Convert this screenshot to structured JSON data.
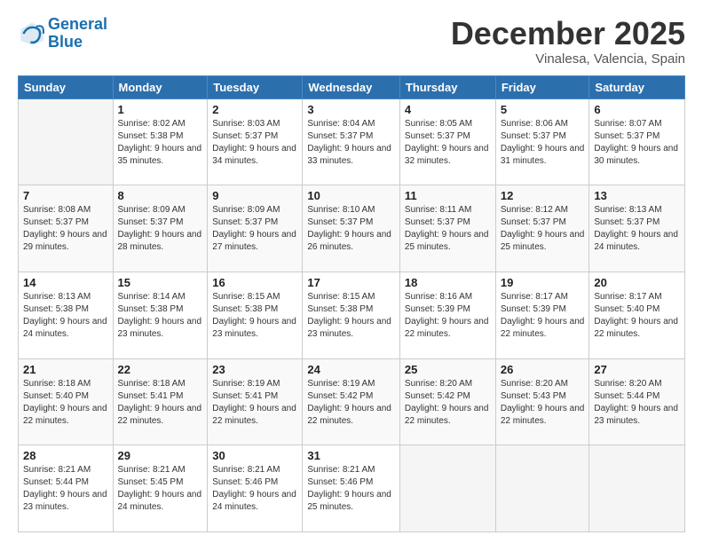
{
  "header": {
    "logo_line1": "General",
    "logo_line2": "Blue",
    "month": "December 2025",
    "location": "Vinalesa, Valencia, Spain"
  },
  "days_of_week": [
    "Sunday",
    "Monday",
    "Tuesday",
    "Wednesday",
    "Thursday",
    "Friday",
    "Saturday"
  ],
  "weeks": [
    [
      {
        "num": "",
        "sunrise": "",
        "sunset": "",
        "daylight": ""
      },
      {
        "num": "1",
        "sunrise": "Sunrise: 8:02 AM",
        "sunset": "Sunset: 5:38 PM",
        "daylight": "Daylight: 9 hours and 35 minutes."
      },
      {
        "num": "2",
        "sunrise": "Sunrise: 8:03 AM",
        "sunset": "Sunset: 5:37 PM",
        "daylight": "Daylight: 9 hours and 34 minutes."
      },
      {
        "num": "3",
        "sunrise": "Sunrise: 8:04 AM",
        "sunset": "Sunset: 5:37 PM",
        "daylight": "Daylight: 9 hours and 33 minutes."
      },
      {
        "num": "4",
        "sunrise": "Sunrise: 8:05 AM",
        "sunset": "Sunset: 5:37 PM",
        "daylight": "Daylight: 9 hours and 32 minutes."
      },
      {
        "num": "5",
        "sunrise": "Sunrise: 8:06 AM",
        "sunset": "Sunset: 5:37 PM",
        "daylight": "Daylight: 9 hours and 31 minutes."
      },
      {
        "num": "6",
        "sunrise": "Sunrise: 8:07 AM",
        "sunset": "Sunset: 5:37 PM",
        "daylight": "Daylight: 9 hours and 30 minutes."
      }
    ],
    [
      {
        "num": "7",
        "sunrise": "Sunrise: 8:08 AM",
        "sunset": "Sunset: 5:37 PM",
        "daylight": "Daylight: 9 hours and 29 minutes."
      },
      {
        "num": "8",
        "sunrise": "Sunrise: 8:09 AM",
        "sunset": "Sunset: 5:37 PM",
        "daylight": "Daylight: 9 hours and 28 minutes."
      },
      {
        "num": "9",
        "sunrise": "Sunrise: 8:09 AM",
        "sunset": "Sunset: 5:37 PM",
        "daylight": "Daylight: 9 hours and 27 minutes."
      },
      {
        "num": "10",
        "sunrise": "Sunrise: 8:10 AM",
        "sunset": "Sunset: 5:37 PM",
        "daylight": "Daylight: 9 hours and 26 minutes."
      },
      {
        "num": "11",
        "sunrise": "Sunrise: 8:11 AM",
        "sunset": "Sunset: 5:37 PM",
        "daylight": "Daylight: 9 hours and 25 minutes."
      },
      {
        "num": "12",
        "sunrise": "Sunrise: 8:12 AM",
        "sunset": "Sunset: 5:37 PM",
        "daylight": "Daylight: 9 hours and 25 minutes."
      },
      {
        "num": "13",
        "sunrise": "Sunrise: 8:13 AM",
        "sunset": "Sunset: 5:37 PM",
        "daylight": "Daylight: 9 hours and 24 minutes."
      }
    ],
    [
      {
        "num": "14",
        "sunrise": "Sunrise: 8:13 AM",
        "sunset": "Sunset: 5:38 PM",
        "daylight": "Daylight: 9 hours and 24 minutes."
      },
      {
        "num": "15",
        "sunrise": "Sunrise: 8:14 AM",
        "sunset": "Sunset: 5:38 PM",
        "daylight": "Daylight: 9 hours and 23 minutes."
      },
      {
        "num": "16",
        "sunrise": "Sunrise: 8:15 AM",
        "sunset": "Sunset: 5:38 PM",
        "daylight": "Daylight: 9 hours and 23 minutes."
      },
      {
        "num": "17",
        "sunrise": "Sunrise: 8:15 AM",
        "sunset": "Sunset: 5:38 PM",
        "daylight": "Daylight: 9 hours and 23 minutes."
      },
      {
        "num": "18",
        "sunrise": "Sunrise: 8:16 AM",
        "sunset": "Sunset: 5:39 PM",
        "daylight": "Daylight: 9 hours and 22 minutes."
      },
      {
        "num": "19",
        "sunrise": "Sunrise: 8:17 AM",
        "sunset": "Sunset: 5:39 PM",
        "daylight": "Daylight: 9 hours and 22 minutes."
      },
      {
        "num": "20",
        "sunrise": "Sunrise: 8:17 AM",
        "sunset": "Sunset: 5:40 PM",
        "daylight": "Daylight: 9 hours and 22 minutes."
      }
    ],
    [
      {
        "num": "21",
        "sunrise": "Sunrise: 8:18 AM",
        "sunset": "Sunset: 5:40 PM",
        "daylight": "Daylight: 9 hours and 22 minutes."
      },
      {
        "num": "22",
        "sunrise": "Sunrise: 8:18 AM",
        "sunset": "Sunset: 5:41 PM",
        "daylight": "Daylight: 9 hours and 22 minutes."
      },
      {
        "num": "23",
        "sunrise": "Sunrise: 8:19 AM",
        "sunset": "Sunset: 5:41 PM",
        "daylight": "Daylight: 9 hours and 22 minutes."
      },
      {
        "num": "24",
        "sunrise": "Sunrise: 8:19 AM",
        "sunset": "Sunset: 5:42 PM",
        "daylight": "Daylight: 9 hours and 22 minutes."
      },
      {
        "num": "25",
        "sunrise": "Sunrise: 8:20 AM",
        "sunset": "Sunset: 5:42 PM",
        "daylight": "Daylight: 9 hours and 22 minutes."
      },
      {
        "num": "26",
        "sunrise": "Sunrise: 8:20 AM",
        "sunset": "Sunset: 5:43 PM",
        "daylight": "Daylight: 9 hours and 22 minutes."
      },
      {
        "num": "27",
        "sunrise": "Sunrise: 8:20 AM",
        "sunset": "Sunset: 5:44 PM",
        "daylight": "Daylight: 9 hours and 23 minutes."
      }
    ],
    [
      {
        "num": "28",
        "sunrise": "Sunrise: 8:21 AM",
        "sunset": "Sunset: 5:44 PM",
        "daylight": "Daylight: 9 hours and 23 minutes."
      },
      {
        "num": "29",
        "sunrise": "Sunrise: 8:21 AM",
        "sunset": "Sunset: 5:45 PM",
        "daylight": "Daylight: 9 hours and 24 minutes."
      },
      {
        "num": "30",
        "sunrise": "Sunrise: 8:21 AM",
        "sunset": "Sunset: 5:46 PM",
        "daylight": "Daylight: 9 hours and 24 minutes."
      },
      {
        "num": "31",
        "sunrise": "Sunrise: 8:21 AM",
        "sunset": "Sunset: 5:46 PM",
        "daylight": "Daylight: 9 hours and 25 minutes."
      },
      {
        "num": "",
        "sunrise": "",
        "sunset": "",
        "daylight": ""
      },
      {
        "num": "",
        "sunrise": "",
        "sunset": "",
        "daylight": ""
      },
      {
        "num": "",
        "sunrise": "",
        "sunset": "",
        "daylight": ""
      }
    ]
  ]
}
